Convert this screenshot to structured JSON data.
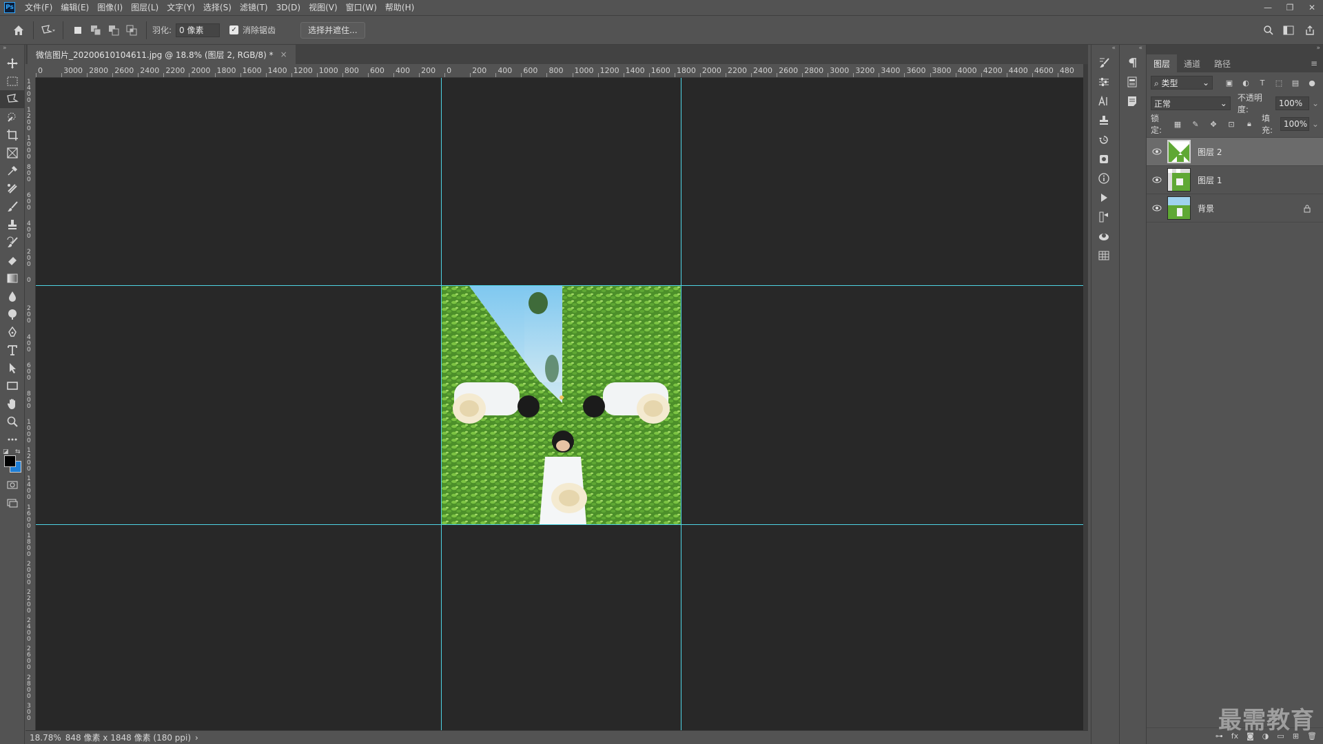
{
  "app": {
    "logo_text": "Ps",
    "menu": [
      "文件(F)",
      "编辑(E)",
      "图像(I)",
      "图层(L)",
      "文字(Y)",
      "选择(S)",
      "滤镜(T)",
      "3D(D)",
      "视图(V)",
      "窗口(W)",
      "帮助(H)"
    ],
    "window_controls": [
      "—",
      "❐",
      "✕"
    ]
  },
  "options": {
    "feather_label": "羽化:",
    "feather_value": "0 像素",
    "antialias_label": "消除锯齿",
    "antialias_checked": true,
    "select_mask_button": "选择并遮住..."
  },
  "document": {
    "tab_title": "微信图片_20200610104611.jpg @ 18.8% (图层 2, RGB/8) *",
    "tab_close": "×",
    "ruler_top": [
      "0",
      "3000",
      "2800",
      "2600",
      "2400",
      "2200",
      "2000",
      "1800",
      "1600",
      "1400",
      "1200",
      "1000",
      "800",
      "600",
      "400",
      "200",
      "0",
      "200",
      "400",
      "600",
      "800",
      "1000",
      "1200",
      "1400",
      "1600",
      "1800",
      "2000",
      "2200",
      "2400",
      "2600",
      "2800",
      "3000",
      "3200",
      "3400",
      "3600",
      "3800",
      "4000",
      "4200",
      "4400",
      "4600",
      "480"
    ],
    "ruler_left": [
      "1400",
      "1200",
      "1000",
      "800",
      "600",
      "400",
      "200",
      "0",
      "200",
      "400",
      "600",
      "800",
      "1000",
      "1200",
      "1400",
      "1600",
      "1800",
      "2000",
      "2200",
      "2400",
      "2600",
      "2800",
      "300"
    ]
  },
  "status": {
    "zoom": "18.78%",
    "doc_info": "848 像素 x 1848 像素 (180 ppi)",
    "arrow": "›"
  },
  "layers_panel": {
    "tabs": [
      "图层",
      "通道",
      "路径"
    ],
    "active_tab": 0,
    "filter_kind": "类型",
    "blend_mode": "正常",
    "opacity_label": "不透明度:",
    "opacity_value": "100%",
    "lock_label": "锁定:",
    "fill_label": "填充:",
    "fill_value": "100%",
    "layers": [
      {
        "name": "图层 2",
        "selected": true,
        "locked": false
      },
      {
        "name": "图层 1",
        "selected": false,
        "locked": false
      },
      {
        "name": "背景",
        "selected": false,
        "locked": true
      }
    ],
    "footer_icons": [
      "link-icon",
      "fx-icon",
      "mask-icon",
      "adjustment-icon",
      "group-icon",
      "new-layer-icon",
      "trash-icon"
    ],
    "footer_fx": "fx"
  },
  "watermark": "最需教育",
  "colors": {
    "accent": "#31a8ff",
    "guide": "#4fd5e6",
    "canvas_bg": "#282828",
    "foreground_swatch": "#000000",
    "background_swatch": "#1e7ed6"
  }
}
